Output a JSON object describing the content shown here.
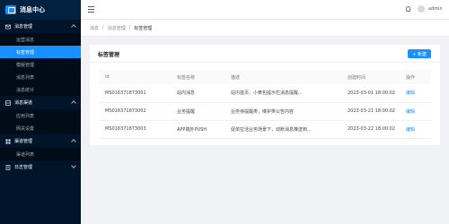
{
  "app": {
    "title": "消息中心"
  },
  "sidebar": {
    "groups": [
      {
        "label": "消息管理",
        "expanded": true,
        "items": [
          {
            "label": "运营消息",
            "active": false
          },
          {
            "label": "标签管理",
            "active": true
          },
          {
            "label": "模版管理",
            "active": false
          },
          {
            "label": "消息列表",
            "active": false
          },
          {
            "label": "消息统计",
            "active": false
          }
        ]
      },
      {
        "label": "消息渠道",
        "expanded": true,
        "items": [
          {
            "label": "应用列表",
            "active": false
          },
          {
            "label": "网关设置",
            "active": false
          }
        ]
      },
      {
        "label": "渠道管理",
        "expanded": true,
        "items": [
          {
            "label": "渠道列表",
            "active": false
          }
        ]
      },
      {
        "label": "日志管理",
        "expanded": false,
        "items": []
      }
    ]
  },
  "header": {
    "user": "admin"
  },
  "breadcrumb": {
    "items": [
      "消息",
      "消息管理"
    ],
    "current": "标签管理"
  },
  "card": {
    "title": "标签管理",
    "add_label": "+ 新建",
    "columns": [
      "id",
      "标签名称",
      "描述",
      "创建时间",
      "操作"
    ],
    "rows": [
      {
        "id": "MS016371873001",
        "name": "站内消息",
        "desc": "站内首页、小黄包提示栏消息提醒...",
        "time": "2023-03-01 18:00:02",
        "action": "编辑"
      },
      {
        "id": "MS016371873002",
        "name": "业务提醒",
        "desc": "业务待提醒类，维护类公告内容",
        "time": "2023-03-21 18:00:02",
        "action": "编辑"
      },
      {
        "id": "MS016371873003",
        "name": "APP端外PUSH",
        "desc": "促单拉活业务场景下，动账消息推送到...",
        "time": "2023-03-22 18:00:02",
        "action": "编辑"
      }
    ]
  }
}
